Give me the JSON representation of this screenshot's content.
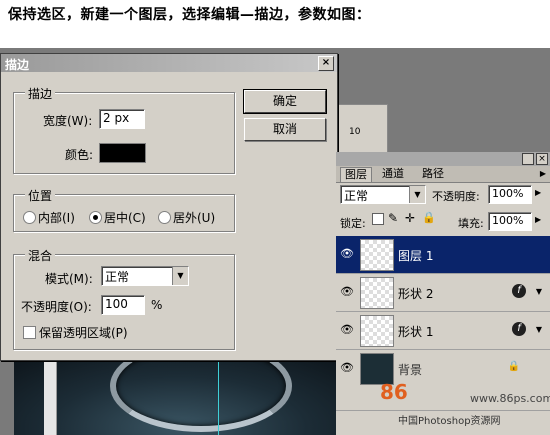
{
  "instruction": "保持选区，新建一个图层，选择编辑—描边，参数如图：",
  "dialog": {
    "title": "描边",
    "close": "×",
    "stroke_group": "描边",
    "width_label": "宽度(W):",
    "width_value": "2 px",
    "color_label": "颜色:",
    "color_value": "#000000",
    "position_group": "位置",
    "positions": [
      "内部(I)",
      "居中(C)",
      "居外(U)"
    ],
    "selected_position": "居中(C)",
    "blend_group": "混合",
    "mode_label": "模式(M):",
    "mode_value": "正常",
    "opacity_label": "不透明度(O):",
    "opacity_value": "100",
    "opacity_unit": "%",
    "preserve_label": "保留透明区域(P)",
    "ok": "确定",
    "cancel": "取消"
  },
  "ruler": {
    "tick": "10"
  },
  "layers": {
    "tabs": [
      "图层",
      "通道",
      "路径"
    ],
    "blend_mode": "正常",
    "opacity_label": "不透明度:",
    "opacity_value": "100%",
    "lock_label": "锁定:",
    "fill_label": "填充:",
    "fill_value": "100%",
    "items": [
      {
        "name": "图层 1",
        "selected": true
      },
      {
        "name": "形状 2",
        "selected": false
      },
      {
        "name": "形状 1",
        "selected": false
      },
      {
        "name": "背景",
        "selected": false
      }
    ]
  },
  "watermark": {
    "logo": "86",
    "site": "www.86ps.com",
    "text": "中国Photoshop资源网"
  }
}
